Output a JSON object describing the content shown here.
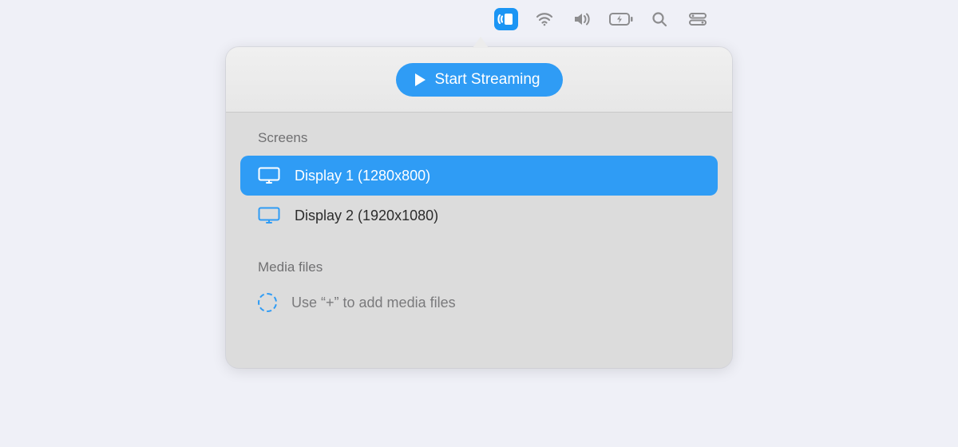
{
  "header": {
    "start_button_label": "Start Streaming"
  },
  "sections": {
    "screens_label": "Screens",
    "media_label": "Media files",
    "media_hint": "Use “+” to add media files"
  },
  "screens": [
    {
      "label": "Display 1 (1280x800)",
      "selected": true
    },
    {
      "label": "Display 2 (1920x1080)",
      "selected": false
    }
  ],
  "colors": {
    "accent": "#2f9cf5",
    "panel_bg": "#dcdcdc"
  }
}
